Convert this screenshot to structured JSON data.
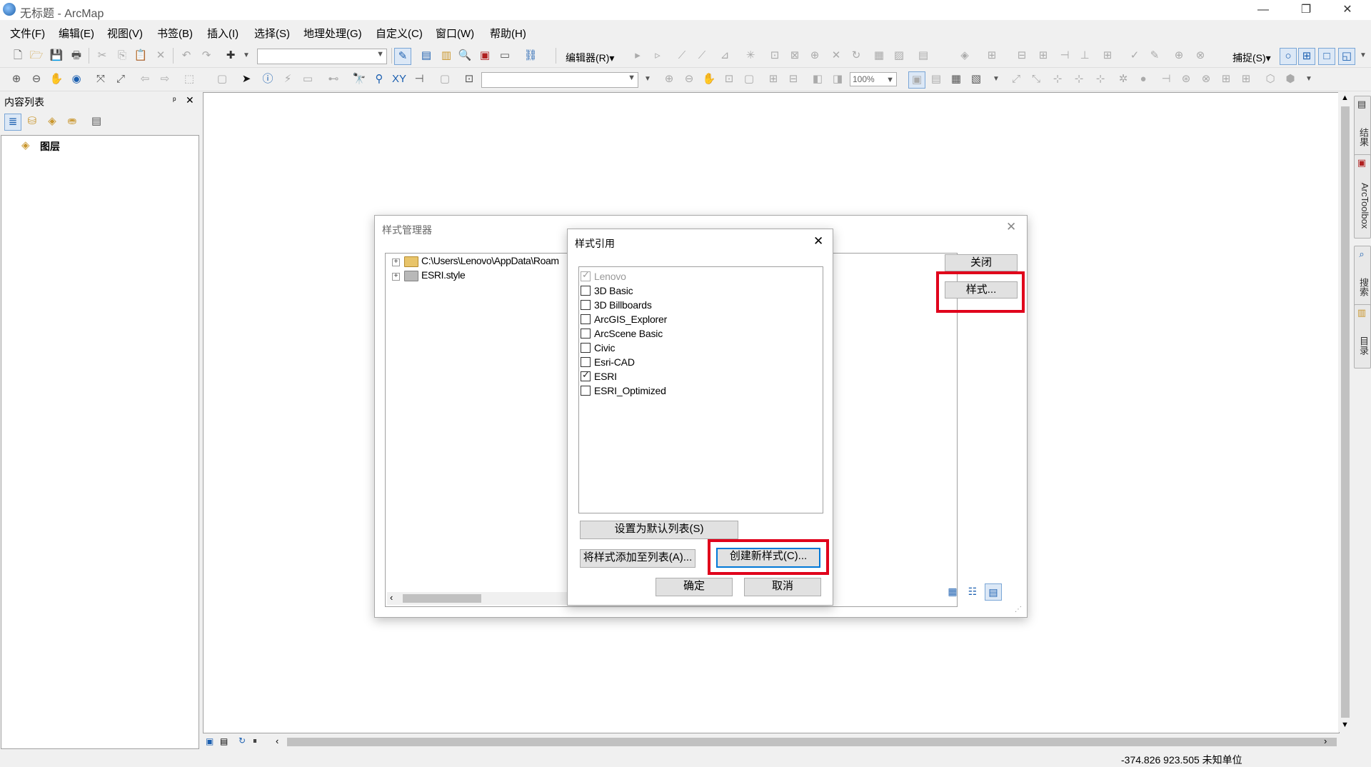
{
  "window": {
    "title": "无标题 - ArcMap",
    "minimize": "—",
    "maximize": "❐",
    "close": "✕"
  },
  "menu": [
    "文件(F)",
    "编辑(E)",
    "视图(V)",
    "书签(B)",
    "插入(I)",
    "选择(S)",
    "地理处理(G)",
    "自定义(C)",
    "窗口(W)",
    "帮助(H)"
  ],
  "toolbar": {
    "editor_label": "编辑器(R)▾",
    "snapping_label": "捕捉(S)▾",
    "zoom_value": "100%"
  },
  "toc": {
    "title": "内容列表",
    "pin": "📌",
    "close": "✕",
    "root_layer": "图层"
  },
  "right_dock": [
    "结果",
    "ArcToolbox",
    "搜索",
    "目录"
  ],
  "status": {
    "coordinates": "-374.826  923.505 未知单位"
  },
  "style_manager": {
    "title": "样式管理器",
    "tree": [
      "C:\\Users\\Lenovo\\AppData\\Roam",
      "ESRI.style"
    ],
    "close_button": "关闭",
    "styles_button": "样式..."
  },
  "style_references": {
    "title": "样式引用",
    "items": [
      {
        "label": "Lenovo",
        "checked": true,
        "disabled": true
      },
      {
        "label": "3D Basic",
        "checked": false,
        "disabled": false
      },
      {
        "label": "3D Billboards",
        "checked": false,
        "disabled": false
      },
      {
        "label": "ArcGIS_Explorer",
        "checked": false,
        "disabled": false
      },
      {
        "label": "ArcScene Basic",
        "checked": false,
        "disabled": false
      },
      {
        "label": "Civic",
        "checked": false,
        "disabled": false
      },
      {
        "label": "Esri-CAD",
        "checked": false,
        "disabled": false
      },
      {
        "label": "ESRI",
        "checked": true,
        "disabled": false
      },
      {
        "label": "ESRI_Optimized",
        "checked": false,
        "disabled": false
      }
    ],
    "set_default_button": "设置为默认列表(S)",
    "add_style_button": "将样式添加至列表(A)...",
    "create_style_button": "创建新样式(C)...",
    "ok_button": "确定",
    "cancel_button": "取消",
    "close_x": "✕"
  },
  "colors": {
    "highlight": "#e0001b",
    "focus": "#0078d7"
  }
}
